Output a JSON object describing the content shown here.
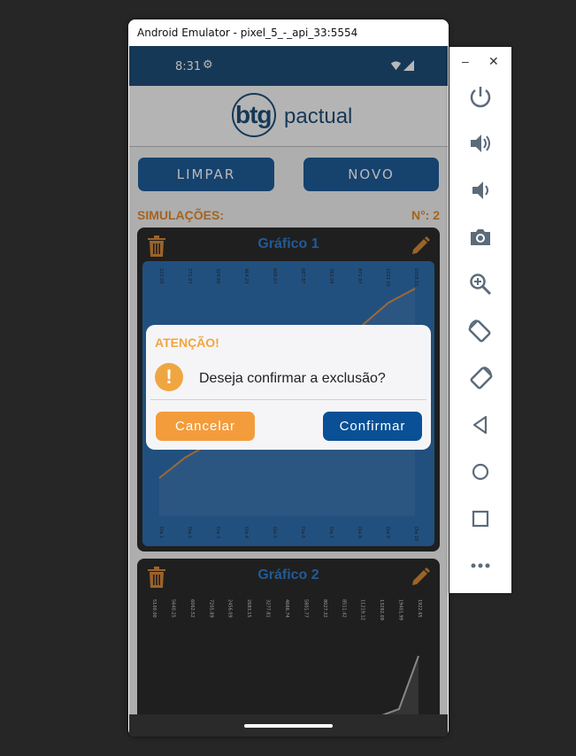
{
  "window": {
    "title": "Android Emulator - pixel_5_-_api_33:5554"
  },
  "status_bar": {
    "time": "8:31"
  },
  "header": {
    "logo_primary": "btg",
    "logo_secondary": "pactual"
  },
  "buttons": {
    "limpar": "LIMPAR",
    "novo": "NOVO"
  },
  "simulations": {
    "label": "SIMULAÇÕES:",
    "count": "N°: 2"
  },
  "cards": [
    {
      "title": "Gráfico 1",
      "top_labels": [
        "223.00",
        "272.97",
        "324.86",
        "464.23",
        "609.07",
        "687.87",
        "763.09",
        "871.97",
        "1033.10",
        "1058.51"
      ],
      "bottom_labels": [
        "Dia 1",
        "Dia 2",
        "Dia 3",
        "Dia 4",
        "Dia 5",
        "Dia 6",
        "Dia 7",
        "Dia 8",
        "Dia 9",
        "Dia 10"
      ]
    },
    {
      "title": "Gráfico 2",
      "top_labels": [
        "5100.00",
        "5640.25",
        "6062.52",
        "7205.89",
        "2456.09",
        "2683.15",
        "3277.81",
        "4666.74",
        "5801.77",
        "8027.32",
        "8511.42",
        "11219.12",
        "13292.09",
        "19401.99",
        "1922.65"
      ]
    }
  ],
  "dialog": {
    "title": "ATENÇÃO!",
    "message": "Deseja confirmar a exclusão?",
    "cancel_label": "Cancelar",
    "confirm_label": "Confirmar"
  },
  "toolbar": {
    "items": [
      "power-icon",
      "volume-up-icon",
      "volume-down-icon",
      "camera-icon",
      "zoom-icon",
      "rotate-left-icon",
      "rotate-right-icon",
      "back-icon",
      "home-icon",
      "overview-icon",
      "more-icon"
    ]
  },
  "colors": {
    "brand_blue": "#1f4e79",
    "button_blue": "#1f5c99",
    "accent_orange": "#e38a2e",
    "chart_blue": "#2f6fb0",
    "confirm_blue": "#0a5096",
    "cancel_orange": "#f39c3c"
  }
}
